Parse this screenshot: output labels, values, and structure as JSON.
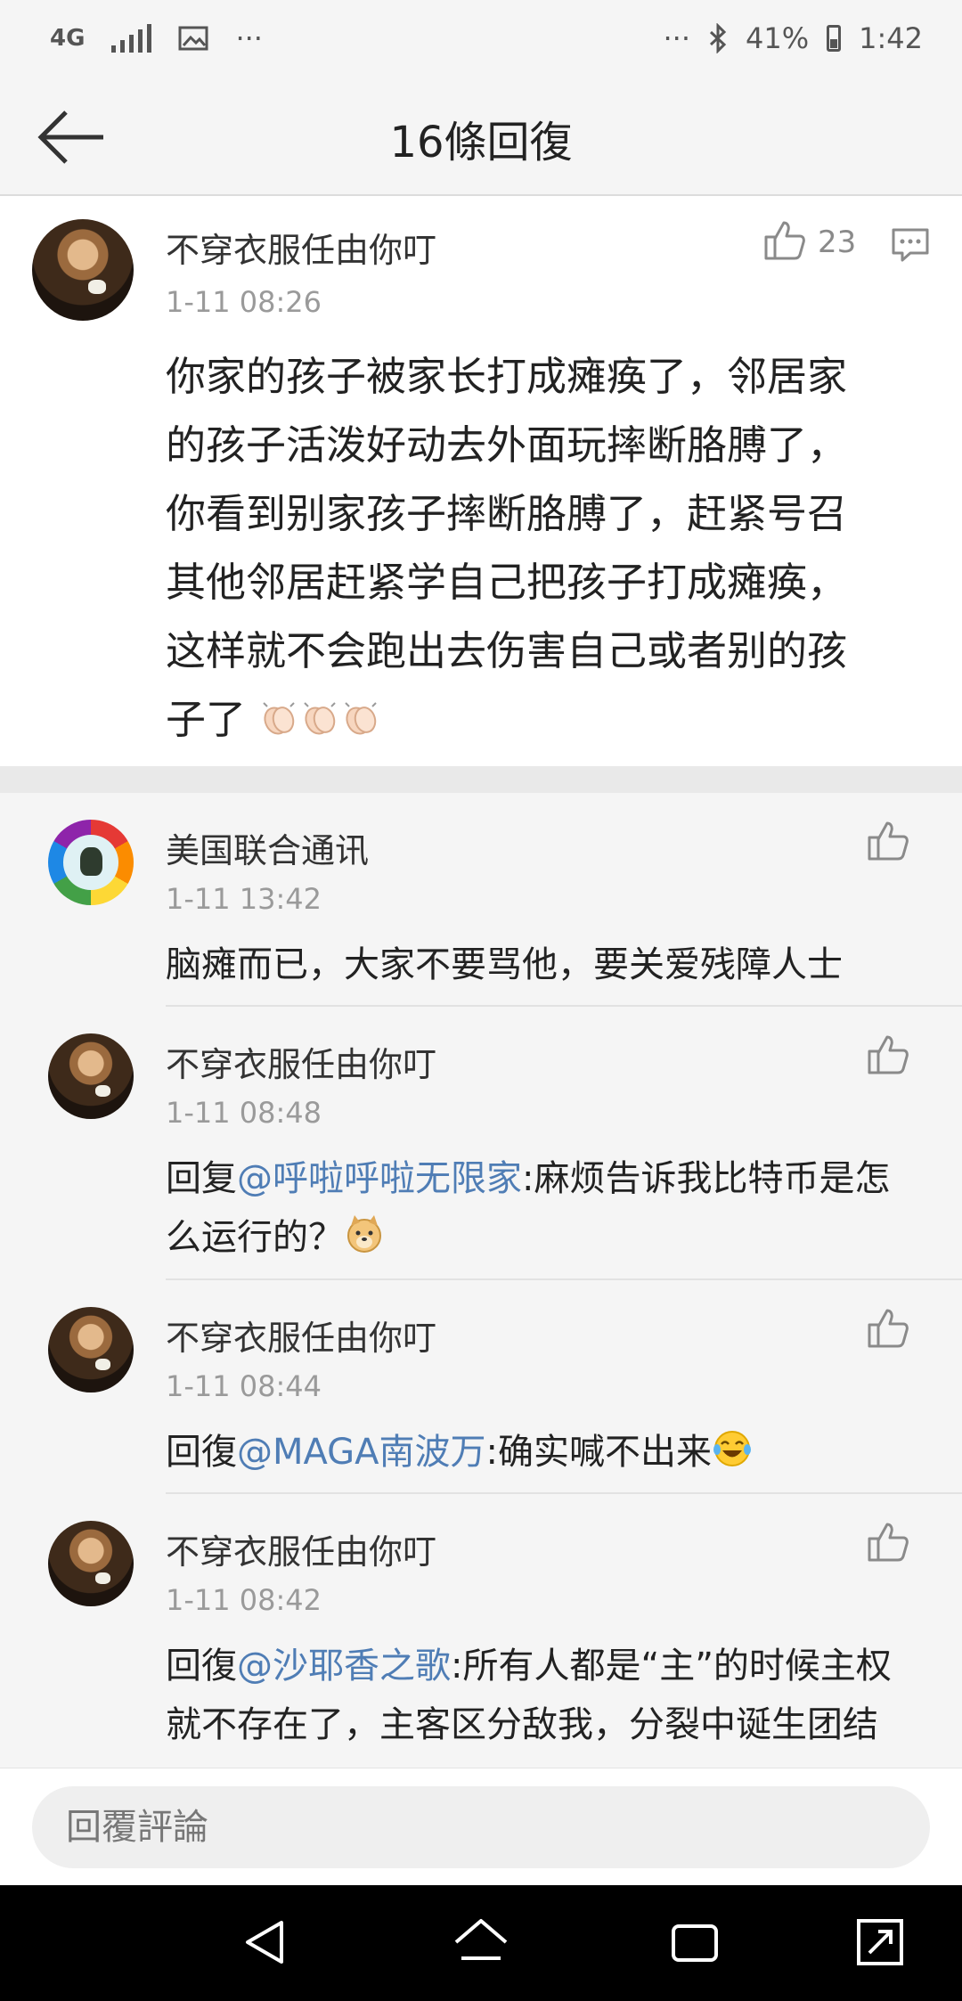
{
  "status_bar": {
    "network": "4G",
    "dots_left": "···",
    "dots_right": "···",
    "battery_percent": "41%",
    "time": "1:42"
  },
  "header": {
    "title": "16條回復"
  },
  "main_comment": {
    "author": "不穿衣服任由你叮",
    "time": "1-11 08:26",
    "like_count": "23",
    "text_lines": [
      "你家的孩子被家长打成瘫痪了，邻居家",
      "的孩子活泼好动去外面玩摔断胳膊了，",
      "你看到别家孩子摔断胳膊了，赶紧号召",
      "其他邻居赶紧学自己把孩子打成瘫痪，",
      "这样就不会跑出去伤害自己或者别的孩",
      "子了"
    ]
  },
  "replies": [
    {
      "author": "美国联合通讯",
      "time": "1-11 13:42",
      "prefix": "",
      "mention": "",
      "text": "脑瘫而已，大家不要骂他，要关爱残障人士"
    },
    {
      "author": "不穿衣服任由你叮",
      "time": "1-11 08:48",
      "prefix": "回复",
      "mention": "@呼啦呼啦无限家",
      "text": ":麻烦告诉我比特币是怎么运行的？"
    },
    {
      "author": "不穿衣服任由你叮",
      "time": "1-11 08:44",
      "prefix": "回復",
      "mention": "@MAGA南波万",
      "text": ":确实喊不出来"
    },
    {
      "author": "不穿衣服任由你叮",
      "time": "1-11 08:42",
      "prefix": "回復",
      "mention": "@沙耶香之歌",
      "text": ":所有人都是“主”的时候主权就不存在了，主客区分敌我，分裂中诞生团结"
    }
  ],
  "reply_input": {
    "placeholder": "回覆評論"
  },
  "icons": {
    "back": "arrow-left-icon",
    "like": "thumbs-up-icon",
    "comment": "comment-icon",
    "clap": "clapping-hands-emoji",
    "doge": "doge-emoji",
    "laugh": "tears-of-joy-emoji",
    "nav_back": "triangle-back-icon",
    "nav_home": "home-icon",
    "nav_recent": "recent-apps-icon",
    "nav_expand": "expand-icon"
  },
  "colors": {
    "mention": "#4f7db5",
    "background": "#f5f5f5",
    "time": "#9a9a9a"
  }
}
